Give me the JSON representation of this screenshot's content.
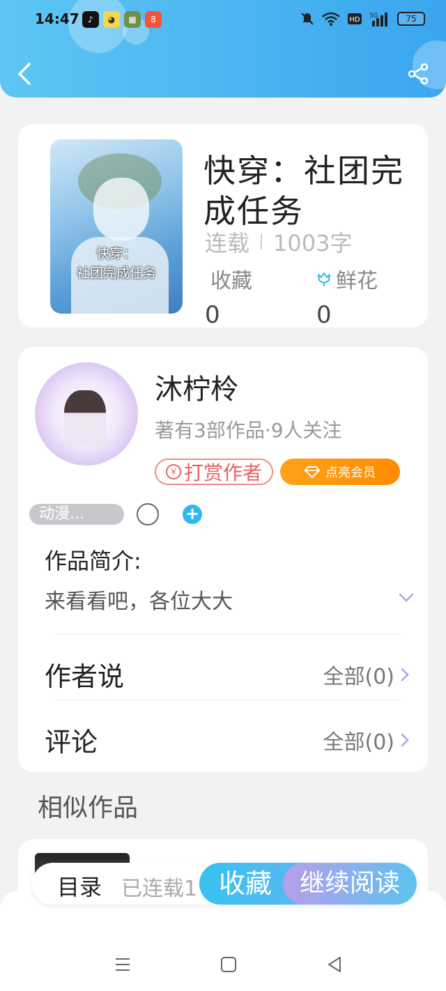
{
  "status_bar": {
    "time": "14:47",
    "battery": "75",
    "apps": [
      "tiktok-icon",
      "app-yellow-icon",
      "app-game-icon",
      "app-red-icon"
    ],
    "indicators": [
      "mute-icon",
      "wifi-icon",
      "hd-icon",
      "5g-signal-icon"
    ],
    "app_red_text": "8"
  },
  "header": {
    "gradient_start": "#5dc6f2",
    "gradient_end": "#39a6f0"
  },
  "book": {
    "title": "快穿：社团完成任务",
    "status": "连载",
    "word_count": "1003字",
    "cover_text_line1": "快穿：",
    "cover_text_line2": "社团完成任务",
    "collect_label": "收藏",
    "collect_value": "0",
    "flower_label": "鲜花",
    "flower_value": "0"
  },
  "author": {
    "name": "沐柠柃",
    "works": "著有3部作品·9人关注",
    "reward_label": "打赏作者",
    "reward_icon_text": "¥",
    "vip_label": "点亮会员"
  },
  "tags": {
    "first": "动漫...",
    "add": "+"
  },
  "intro": {
    "title": "作品简介:",
    "text": "来看看吧，各位大大"
  },
  "rows": {
    "author_says": "作者说",
    "author_says_right": "全部(0)",
    "comments": "评论",
    "comments_right": "全部(0)"
  },
  "similar": {
    "title": "相似作品"
  },
  "bottom_bar": {
    "toc": "目录",
    "toc_status": "已连载1",
    "favorite": "收藏",
    "continue": "继续阅读"
  }
}
